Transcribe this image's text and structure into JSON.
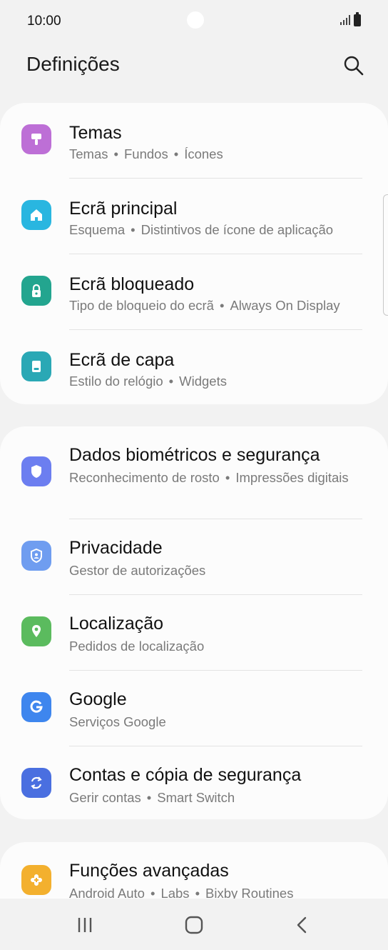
{
  "status": {
    "time": "10:00"
  },
  "header": {
    "title": "Definições"
  },
  "group1": [
    {
      "label": "Temas",
      "subs": [
        "Temas",
        "Fundos",
        "Ícones"
      ],
      "color": "#bd6fd6"
    },
    {
      "label": "Ecrã principal",
      "subs": [
        "Esquema",
        "Distintivos de ícone de aplicação"
      ],
      "color": "#29b6e0"
    },
    {
      "label": "Ecrã bloqueado",
      "subs": [
        "Tipo de bloqueio do ecrã",
        "Always On Display"
      ],
      "color": "#23a58f"
    },
    {
      "label": "Ecrã de capa",
      "subs": [
        "Estilo do relógio",
        "Widgets"
      ],
      "color": "#2aa8b5"
    }
  ],
  "group2": [
    {
      "label": "Dados biométricos e segurança",
      "subs": [
        "Reconhecimento de rosto",
        "Impressões digitais"
      ],
      "color": "#6c7ef0"
    },
    {
      "label": "Privacidade",
      "subs": [
        "Gestor de autorizações"
      ],
      "color": "#6f9df0"
    },
    {
      "label": "Localização",
      "subs": [
        "Pedidos de localização"
      ],
      "color": "#5bbb5e"
    },
    {
      "label": "Google",
      "subs": [
        "Serviços Google"
      ],
      "color": "#3e86ee"
    },
    {
      "label": "Contas e cópia de segurança",
      "subs": [
        "Gerir contas",
        "Smart Switch"
      ],
      "color": "#4a6fe0"
    }
  ],
  "group3": [
    {
      "label": "Funções avançadas",
      "subs": [
        "Android Auto",
        "Labs",
        "Bixby Routines"
      ],
      "color": "#f3b02e"
    }
  ]
}
